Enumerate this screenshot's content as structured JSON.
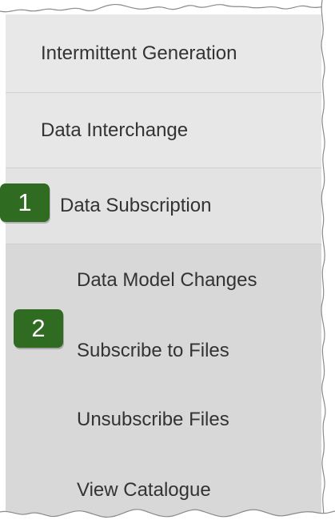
{
  "menu": {
    "items": [
      {
        "label": "Intermittent Generation"
      },
      {
        "label": "Data Interchange"
      },
      {
        "label": "Data Subscription"
      },
      {
        "label": "Data Model Changes"
      },
      {
        "label": "Subscribe to Files"
      },
      {
        "label": "Unsubscribe Files"
      },
      {
        "label": "View Catalogue"
      }
    ]
  },
  "callouts": [
    {
      "label": "1"
    },
    {
      "label": "2"
    }
  ],
  "colors": {
    "callout": "#2f6c22",
    "menu_background": "#d9d9d9",
    "menu_text": "#333333"
  }
}
